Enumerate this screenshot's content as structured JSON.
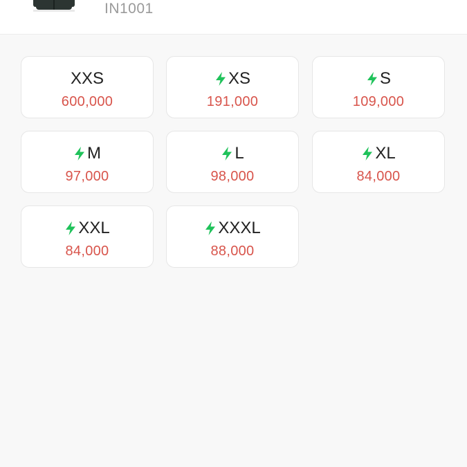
{
  "product": {
    "sku": "IN1001",
    "thumbnail_icon": "jacket-thumbnail"
  },
  "sizes": [
    {
      "label": "XXS",
      "price": "600,000",
      "quick": false
    },
    {
      "label": "XS",
      "price": "191,000",
      "quick": true
    },
    {
      "label": "S",
      "price": "109,000",
      "quick": true
    },
    {
      "label": "M",
      "price": "97,000",
      "quick": true
    },
    {
      "label": "L",
      "price": "98,000",
      "quick": true
    },
    {
      "label": "XL",
      "price": "84,000",
      "quick": true
    },
    {
      "label": "XXL",
      "price": "84,000",
      "quick": true
    },
    {
      "label": "XXXL",
      "price": "88,000",
      "quick": true
    }
  ],
  "colors": {
    "price": "#d8544b",
    "bolt": "#1fc25a",
    "label": "#222222"
  }
}
